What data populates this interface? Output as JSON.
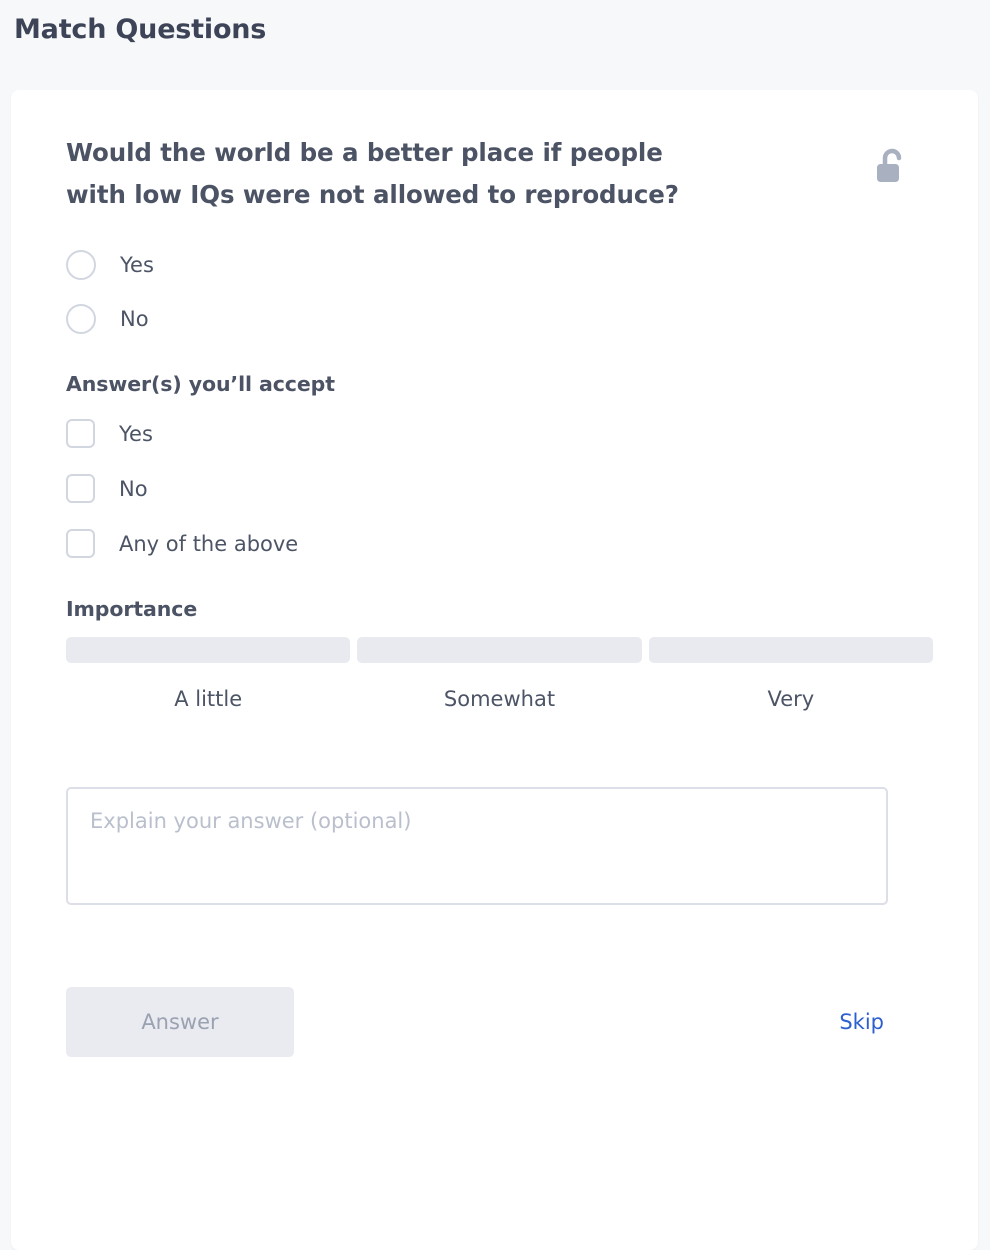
{
  "page": {
    "title": "Match Questions",
    "background_color": "#f7f8fa",
    "card_background_color": "#ffffff"
  },
  "question_card": {
    "question_text": "Would the world be a better place if people with low IQs were not allowed to reproduce?",
    "lock_icon": "unlocked-padlock-icon",
    "your_answer": {
      "options": [
        {
          "label": "Yes",
          "selected": false
        },
        {
          "label": "No",
          "selected": false
        }
      ]
    },
    "accepted_answers": {
      "heading": "Answer(s) you’ll accept",
      "options": [
        {
          "label": "Yes",
          "checked": false
        },
        {
          "label": "No",
          "checked": false
        },
        {
          "label": "Any of the above",
          "checked": false
        }
      ]
    },
    "importance": {
      "heading": "Importance",
      "levels": [
        {
          "label": "A little",
          "selected": false
        },
        {
          "label": "Somewhat",
          "selected": false
        },
        {
          "label": "Very",
          "selected": false
        }
      ],
      "bar_color": "#e9eaf0"
    },
    "explanation": {
      "placeholder": "Explain your answer (optional)",
      "value": ""
    },
    "actions": {
      "answer_label": "Answer",
      "answer_disabled": true,
      "skip_label": "Skip",
      "skip_color": "#2e5fd0"
    }
  }
}
